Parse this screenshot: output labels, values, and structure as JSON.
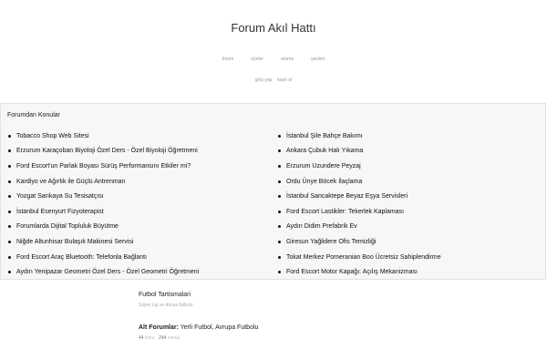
{
  "header": {
    "site_title": "Forum Akıl Hattı",
    "nav": [
      "forum",
      "üyeler",
      "arama",
      "yardım"
    ],
    "auth": [
      "giriş yap",
      "kayıt ol"
    ]
  },
  "topics": {
    "heading": "Forumdan Konular",
    "left": [
      "Tobacco Shop Web Sitesi",
      "Erzurum Karaçoban Biyoloji Özel Ders - Özel Biyoloji Öğretmeni",
      "Ford Escort'un Parlak Boyası Sürüş Performansını Etkiler mi?",
      "Kardiyo ve Ağırlık ile Güçlü Antrenman",
      "Yozgat Sarıkaya Su Tesisatçısı",
      "İstanbul Esenyurt Fizyoterapist",
      "Forumlarda Dijital Topluluk Büyütme",
      "Niğde Altunhisar Bulaşık Makinesi Servisi",
      "Ford Escort Araç Bluetooth: Telefonla Bağlantı",
      "Aydın Yenipazar Geometri Özel Ders - Özel Geometri Öğretmeni"
    ],
    "right": [
      "İstanbul Şile Bahçe Bakımı",
      "Ankara Çubuk Halı Yıkama",
      "Erzurum Uzundere Peyzaj",
      "Ordu Ünye Böcek İlaçlama",
      "İstanbul Sancaktepe Beyaz Eşya Servisleri",
      "Ford Escort Lastikler: Tekerlek Kaplaması",
      "Aydın Didim Prefabrik Ev",
      "Giresun Yağlidere Ofis Temizliği",
      "Tokat Merkez Pomeranian Boo Ücretsiz Sahiplendirme",
      "Ford Escort Motor Kapağı: Açılış Mekanizması"
    ]
  },
  "forum": {
    "name": "Futbol Tartismalari",
    "description": "Süper Lig ve dünya futbolu",
    "subforums_label": "Alt Forumlar:",
    "subforums": [
      "Yerli Futbol",
      "Avrupa Futbolu"
    ],
    "topics_count": "44",
    "topics_label": "konu",
    "posts_count": "294",
    "posts_label": "mesaj"
  }
}
